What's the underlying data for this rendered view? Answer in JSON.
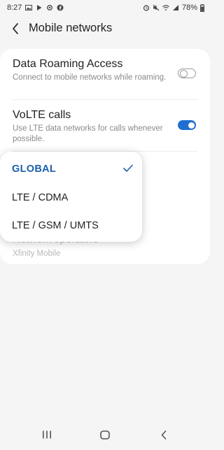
{
  "status_bar": {
    "time": "8:27",
    "battery": "78%",
    "left_icons": [
      "gallery-icon",
      "play-store-icon",
      "sync-icon",
      "facebook-icon"
    ],
    "right_icons": [
      "alarm-icon",
      "mute-icon",
      "wifi-icon",
      "signal-icon",
      "battery-icon"
    ]
  },
  "header": {
    "title": "Mobile networks"
  },
  "settings": {
    "data_roaming": {
      "title": "Data Roaming Access",
      "subtitle": "Connect to mobile networks while roaming.",
      "enabled": false
    },
    "volte": {
      "title": "VoLTE calls",
      "subtitle": "Use LTE data networks for calls whenever possible.",
      "enabled": true
    },
    "network_operators": {
      "title": "Network operators",
      "subtitle": "Xfinity Mobile"
    }
  },
  "network_mode_menu": {
    "options": [
      "GLOBAL",
      "LTE / CDMA",
      "LTE / GSM / UMTS"
    ],
    "selected": "GLOBAL"
  },
  "colors": {
    "accent": "#1f6fd0",
    "selected_text": "#1b5fab",
    "background": "#f5f5f5"
  },
  "nav": {
    "items": [
      "recent-apps-button",
      "home-button",
      "back-button"
    ]
  }
}
